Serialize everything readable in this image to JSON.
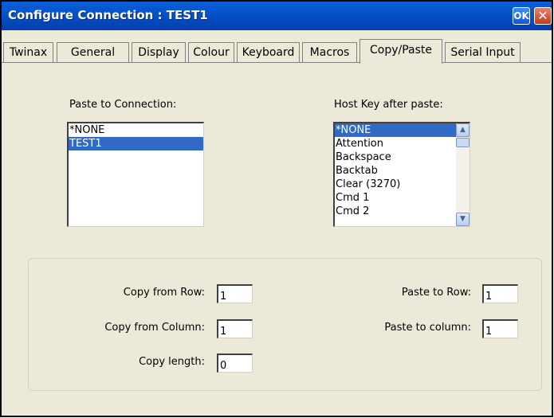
{
  "window": {
    "title": "Configure Connection : TEST1",
    "ok_label": "OK",
    "close_label": "✕"
  },
  "tabs": [
    {
      "label": "Twinax",
      "active": false
    },
    {
      "label": "General",
      "active": false
    },
    {
      "label": "Display",
      "active": false
    },
    {
      "label": "Colour",
      "active": false
    },
    {
      "label": "Keyboard",
      "active": false
    },
    {
      "label": "Macros",
      "active": false
    },
    {
      "label": "Copy/Paste",
      "active": true
    },
    {
      "label": "Serial Input",
      "active": false
    }
  ],
  "paste_to_connection": {
    "label": "Paste to Connection:",
    "items": [
      {
        "text": "*NONE",
        "selected": false
      },
      {
        "text": "TEST1",
        "selected": true
      }
    ]
  },
  "host_key": {
    "label": "Host Key after paste:",
    "items": [
      {
        "text": "*NONE",
        "selected": true
      },
      {
        "text": "Attention",
        "selected": false
      },
      {
        "text": "Backspace",
        "selected": false
      },
      {
        "text": "Backtab",
        "selected": false
      },
      {
        "text": "Clear (3270)",
        "selected": false
      },
      {
        "text": "Cmd  1",
        "selected": false
      },
      {
        "text": "Cmd  2",
        "selected": false
      }
    ],
    "scroll_up_icon": "▲",
    "scroll_down_icon": "▼"
  },
  "copy_paste": {
    "copy_from_row": {
      "label": "Copy from Row:",
      "value": "1"
    },
    "copy_from_column": {
      "label": "Copy from Column:",
      "value": "1"
    },
    "copy_length": {
      "label": "Copy length:",
      "value": "0"
    },
    "paste_to_row": {
      "label": "Paste to Row:",
      "value": "1"
    },
    "paste_to_column": {
      "label": "Paste to column:",
      "value": "1"
    }
  },
  "colors": {
    "titlebar": "#0452c8",
    "selection": "#316ac5",
    "dialog_bg": "#ece9d8"
  }
}
